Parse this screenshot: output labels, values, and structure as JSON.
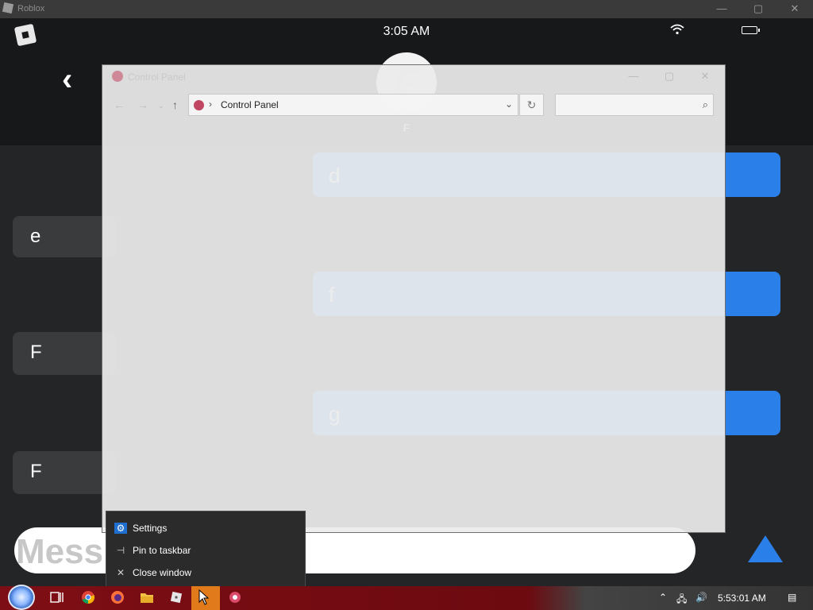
{
  "roblox_window": {
    "title": "Roblox",
    "minimize": "—",
    "maximize": "▢",
    "close": "✕"
  },
  "status_bar": {
    "time": "3:05 AM"
  },
  "chat": {
    "avatar_letter": "F",
    "contact_name": "F",
    "sent_messages": [
      "d",
      "f",
      "g"
    ],
    "received_messages": [
      "e",
      "F",
      "F"
    ],
    "composer_placeholder": "Mess"
  },
  "control_panel": {
    "title": "Control Panel",
    "breadcrumb": "Control Panel",
    "search_placeholder": ""
  },
  "context_menu": {
    "items": [
      {
        "icon": "gear-icon",
        "label": "Settings"
      },
      {
        "icon": "pin-icon",
        "label": "Pin to taskbar"
      },
      {
        "icon": "close-icon",
        "label": "Close window"
      }
    ]
  },
  "taskbar": {
    "clock": "5:53:01 AM"
  },
  "colors": {
    "roblox_bg": "#232527",
    "bubble_blue": "#2a7fe8",
    "taskbar_red": "#7e0e15",
    "active_app": "#e07a1b"
  }
}
